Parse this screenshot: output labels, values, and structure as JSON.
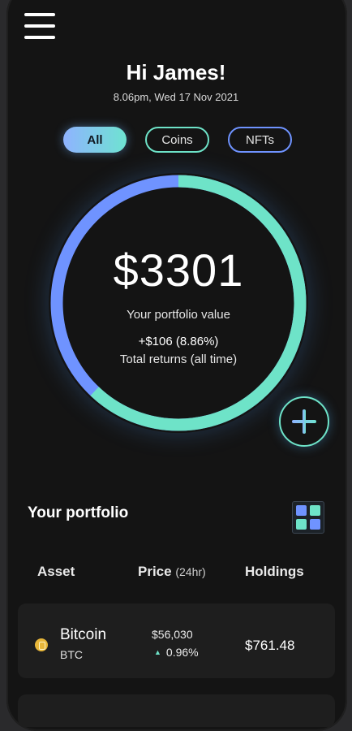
{
  "header": {
    "greeting": "Hi James!",
    "datetime": "8.06pm, Wed 17 Nov 2021"
  },
  "filters": {
    "all": "All",
    "coins": "Coins",
    "nfts": "NFTs",
    "selected": "All"
  },
  "portfolio_summary": {
    "value": "$3301",
    "value_label": "Your portfolio value",
    "returns": "+$106 (8.86%)",
    "returns_label": "Total returns (all time)",
    "colors": {
      "coins": "#6ee3c8",
      "nfts": "#6f93ff"
    }
  },
  "portfolio": {
    "title": "Your portfolio",
    "columns": {
      "asset": "Asset",
      "price": "Price",
      "price_period": "(24hr)",
      "holdings": "Holdings"
    },
    "rows": [
      {
        "name": "Bitcoin",
        "symbol": "BTC",
        "price": "$56,030",
        "change": "0.96%",
        "holdings": "$761.48"
      }
    ]
  }
}
